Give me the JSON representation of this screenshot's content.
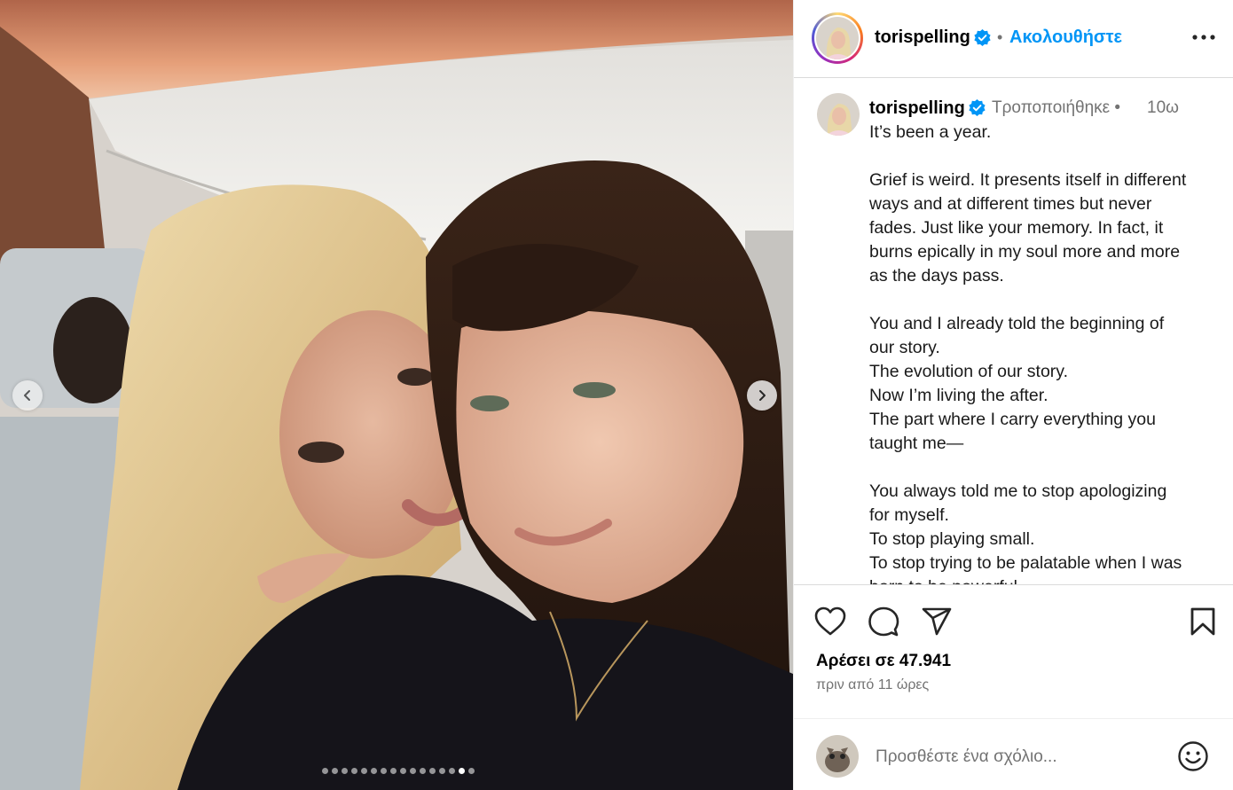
{
  "media": {
    "slide_count": 16,
    "active_slide": 15,
    "prev_icon": "chevron-left-icon",
    "next_icon": "chevron-right-icon"
  },
  "header": {
    "username": "torispelling",
    "separator": "•",
    "follow_label": "Ακολουθήστε",
    "more_icon": "more-horizontal-icon"
  },
  "caption": {
    "username": "torispelling",
    "edited_label": "Τροποποιήθηκε •",
    "time": "10ω",
    "lines": [
      "It’s been a year.",
      "",
      "Grief is weird. It presents itself in different",
      "ways and at different times but never",
      "fades. Just like your memory. In fact, it",
      "burns epically in my soul more and more",
      "as the days pass.",
      "",
      "You and I already told the beginning of",
      "our story.",
      "The evolution of our story.",
      "Now I’m living the after.",
      "The part where I carry everything you",
      "taught me—",
      "",
      "You always told me to stop apologizing",
      "for myself.",
      "To stop playing small.",
      "To stop trying to be palatable when I was",
      "born to be powerful."
    ]
  },
  "actions": {
    "like_icon": "heart-icon",
    "comment_icon": "comment-icon",
    "share_icon": "send-icon",
    "save_icon": "bookmark-icon"
  },
  "likes_text": "Αρέσει σε 47.941",
  "posted_text": "πριν από 11 ώρες",
  "comment": {
    "placeholder": "Προσθέστε ένα σχόλιο...",
    "emoji_icon": "emoji-icon"
  },
  "colors": {
    "link": "#0095f6",
    "verified": "#0095f6",
    "secondary_text": "#737373"
  }
}
